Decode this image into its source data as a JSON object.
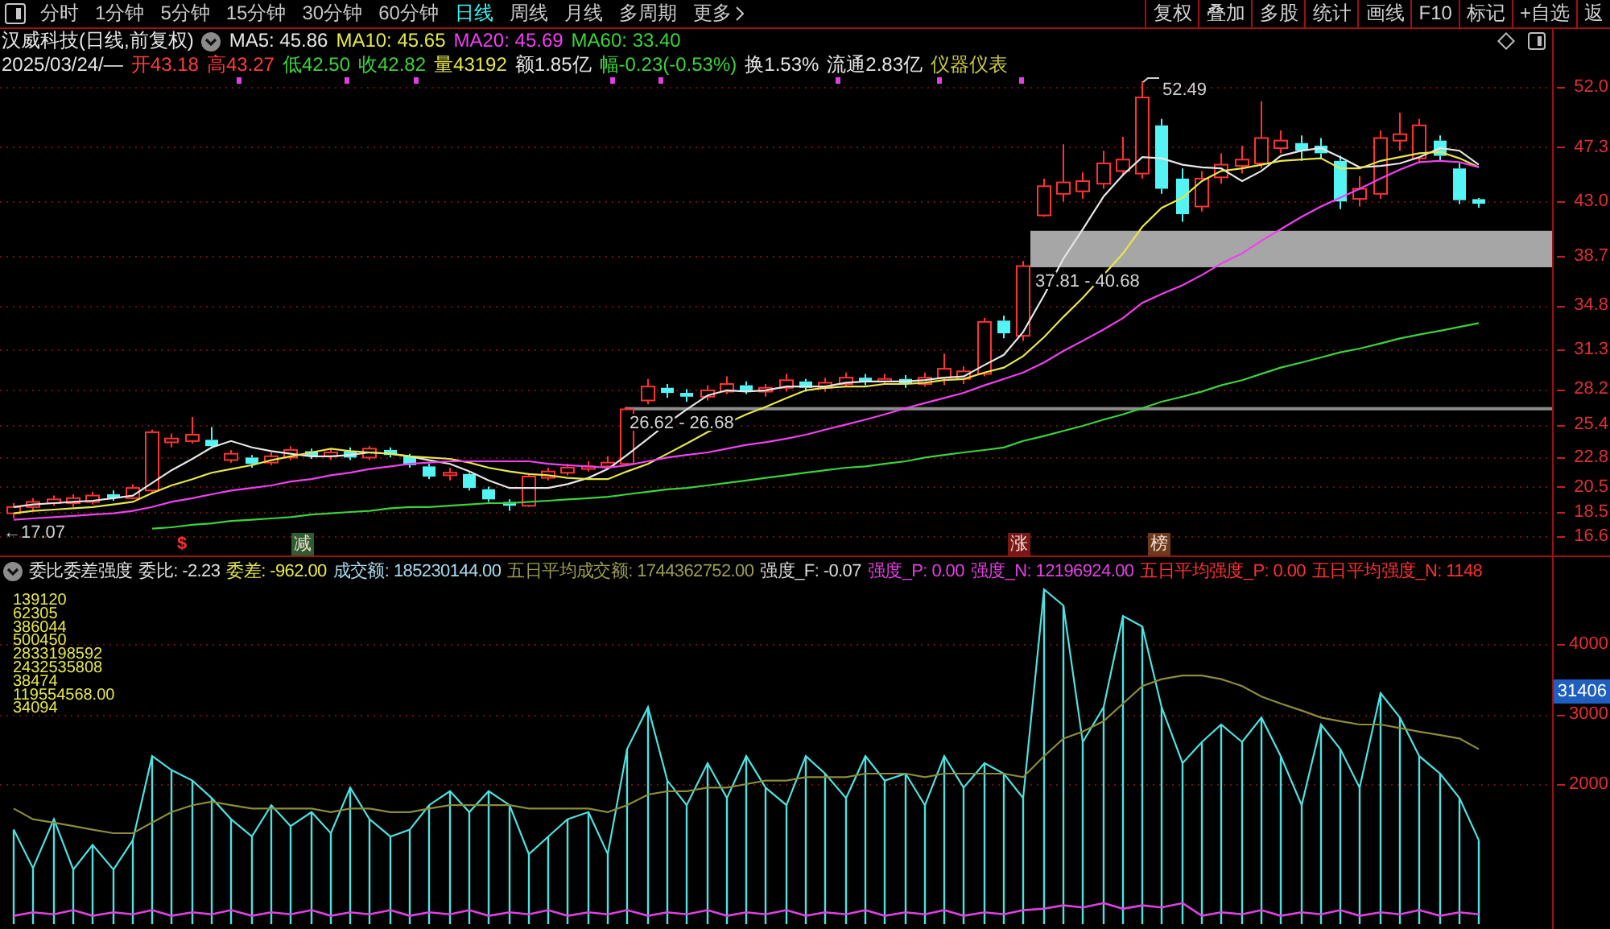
{
  "toolbar": {
    "tabs": [
      {
        "label": "分时",
        "selected": false
      },
      {
        "label": "1分钟",
        "selected": false
      },
      {
        "label": "5分钟",
        "selected": false
      },
      {
        "label": "15分钟",
        "selected": false
      },
      {
        "label": "30分钟",
        "selected": false
      },
      {
        "label": "60分钟",
        "selected": false
      },
      {
        "label": "日线",
        "selected": true
      },
      {
        "label": "周线",
        "selected": false
      },
      {
        "label": "月线",
        "selected": false
      },
      {
        "label": "多周期",
        "selected": false
      }
    ],
    "more": "更多",
    "actions": [
      "复权",
      "叠加",
      "多股",
      "统计",
      "画线",
      "F10",
      "标记",
      "+自选",
      "返"
    ]
  },
  "quote": {
    "title": "汉威科技(日线,前复权)",
    "averages": [
      {
        "label": "MA5: 45.86",
        "color": "#e6e6e6"
      },
      {
        "label": "MA10: 45.65",
        "color": "#e6e64c"
      },
      {
        "label": "MA20: 45.69",
        "color": "#f040f0"
      },
      {
        "label": "MA60: 33.40",
        "color": "#3cd23c"
      }
    ],
    "date": "2025/03/24/—",
    "fields": [
      {
        "text": "开43.18",
        "color": "#ff3c3c"
      },
      {
        "text": "高43.27",
        "color": "#ff3c3c"
      },
      {
        "text": "低42.50",
        "color": "#3cd23c"
      },
      {
        "text": "收42.82",
        "color": "#3cd23c"
      },
      {
        "text": "量43192",
        "color": "#e6e64c"
      },
      {
        "text": "额1.85亿",
        "color": "#e6e6e6"
      },
      {
        "text": "幅-0.23(-0.53%)",
        "color": "#3cd23c"
      },
      {
        "text": "换1.53%",
        "color": "#e6e6e6"
      },
      {
        "text": "流通2.83亿",
        "color": "#e6e6e6"
      },
      {
        "text": "仪器仪表",
        "color": "#c8c83c"
      }
    ]
  },
  "price_chart": {
    "chart_data": {
      "type": "candlestick",
      "grid": true,
      "ylim": [
        16.6,
        56.73
      ],
      "yticks": [
        {
          "value": 52,
          "label": "52.0"
        },
        {
          "value": 47.3,
          "label": "47.3"
        },
        {
          "value": 43,
          "label": "43.0"
        },
        {
          "value": 38.7,
          "label": "38.7"
        },
        {
          "value": 34.8,
          "label": "34.8"
        },
        {
          "value": 31.3,
          "label": "31.3"
        },
        {
          "value": 28.2,
          "label": "28.2"
        },
        {
          "value": 25.4,
          "label": "25.4"
        },
        {
          "value": 22.8,
          "label": "22.8"
        },
        {
          "value": 20.5,
          "label": "20.5"
        },
        {
          "value": 18.5,
          "label": "18.5"
        },
        {
          "value": 16.6,
          "label": "16.6"
        }
      ],
      "ohlc": [
        [
          18.4,
          19.2,
          18.0,
          18.9
        ],
        [
          18.9,
          19.6,
          18.6,
          19.3
        ],
        [
          19.2,
          19.8,
          19.0,
          19.5
        ],
        [
          19.2,
          19.9,
          18.9,
          19.6
        ],
        [
          19.3,
          20.1,
          19.1,
          19.8
        ],
        [
          19.9,
          20.2,
          19.4,
          19.6
        ],
        [
          19.6,
          20.7,
          19.5,
          20.4
        ],
        [
          20.2,
          25.0,
          20.0,
          24.8
        ],
        [
          24.0,
          24.7,
          23.6,
          24.3
        ],
        [
          24.1,
          26.0,
          23.9,
          24.6
        ],
        [
          24.2,
          25.2,
          23.5,
          23.7
        ],
        [
          22.6,
          23.4,
          22.4,
          23.1
        ],
        [
          22.8,
          23.0,
          22.0,
          22.3
        ],
        [
          22.4,
          23.2,
          22.2,
          22.9
        ],
        [
          22.8,
          23.7,
          22.6,
          23.4
        ],
        [
          23.3,
          23.5,
          22.7,
          22.9
        ],
        [
          22.9,
          23.5,
          22.6,
          23.2
        ],
        [
          23.3,
          23.6,
          22.6,
          22.8
        ],
        [
          22.8,
          23.7,
          22.6,
          23.5
        ],
        [
          23.4,
          23.6,
          22.8,
          23.0
        ],
        [
          22.9,
          23.1,
          22.0,
          22.2
        ],
        [
          22.1,
          22.3,
          21.1,
          21.3
        ],
        [
          21.4,
          22.0,
          21.0,
          21.6
        ],
        [
          21.5,
          21.6,
          20.2,
          20.4
        ],
        [
          20.3,
          20.5,
          19.3,
          19.5
        ],
        [
          19.3,
          19.5,
          18.6,
          19.0
        ],
        [
          19.0,
          21.5,
          18.9,
          21.3
        ],
        [
          21.2,
          22.0,
          21.0,
          21.7
        ],
        [
          21.6,
          22.3,
          21.4,
          22.0
        ],
        [
          21.9,
          22.5,
          21.7,
          22.1
        ],
        [
          22.1,
          22.9,
          21.9,
          22.4
        ],
        [
          22.3,
          26.8,
          22.2,
          26.6
        ],
        [
          27.3,
          29.0,
          27.0,
          28.4
        ],
        [
          28.3,
          28.6,
          27.5,
          27.9
        ],
        [
          27.9,
          28.2,
          27.2,
          27.6
        ],
        [
          27.6,
          28.5,
          27.3,
          28.1
        ],
        [
          28.0,
          29.2,
          27.8,
          28.6
        ],
        [
          28.5,
          28.8,
          27.8,
          28.0
        ],
        [
          28.0,
          28.6,
          27.6,
          28.3
        ],
        [
          28.3,
          29.4,
          28.0,
          28.9
        ],
        [
          28.8,
          29.0,
          28.0,
          28.3
        ],
        [
          28.3,
          29.1,
          28.0,
          28.7
        ],
        [
          28.6,
          29.5,
          28.4,
          29.1
        ],
        [
          29.1,
          29.4,
          28.5,
          28.8
        ],
        [
          28.8,
          29.4,
          28.6,
          29.0
        ],
        [
          29.0,
          29.3,
          28.3,
          28.6
        ],
        [
          28.6,
          29.5,
          28.4,
          29.1
        ],
        [
          29.1,
          31.0,
          28.5,
          29.8
        ],
        [
          29.0,
          30.0,
          28.6,
          29.6
        ],
        [
          29.4,
          33.8,
          29.2,
          33.5
        ],
        [
          33.6,
          34.0,
          32.2,
          32.6
        ],
        [
          32.4,
          38.3,
          32.0,
          37.9
        ],
        [
          41.9,
          44.8,
          41.8,
          44.2
        ],
        [
          43.6,
          47.5,
          43.0,
          44.5
        ],
        [
          43.8,
          45.3,
          43.2,
          44.6
        ],
        [
          44.4,
          47.0,
          44.0,
          46.0
        ],
        [
          45.4,
          48.1,
          45.0,
          46.3
        ],
        [
          45.2,
          52.49,
          44.8,
          51.2
        ],
        [
          49.0,
          49.5,
          43.6,
          44.0
        ],
        [
          44.8,
          45.6,
          41.4,
          42.0
        ],
        [
          42.6,
          45.4,
          42.2,
          44.8
        ],
        [
          44.9,
          46.8,
          44.4,
          45.9
        ],
        [
          45.8,
          47.4,
          45.2,
          46.3
        ],
        [
          46.0,
          50.9,
          45.6,
          48.0
        ],
        [
          47.2,
          48.6,
          46.8,
          47.8
        ],
        [
          47.6,
          48.2,
          46.2,
          47.0
        ],
        [
          47.4,
          48.0,
          46.4,
          46.8
        ],
        [
          46.2,
          46.6,
          42.4,
          43.0
        ],
        [
          43.2,
          45.0,
          42.6,
          44.0
        ],
        [
          43.6,
          48.6,
          43.2,
          48.0
        ],
        [
          47.8,
          50.0,
          47.0,
          48.3
        ],
        [
          46.4,
          49.5,
          46.0,
          49.0
        ],
        [
          47.8,
          48.2,
          46.2,
          46.6
        ],
        [
          45.6,
          46.0,
          42.8,
          43.1
        ],
        [
          43.18,
          43.27,
          42.5,
          42.82
        ]
      ],
      "series": [
        {
          "type": "line",
          "color": "#e6e6e6",
          "values": [
            18.9,
            19.1,
            19.2,
            19.3,
            19.4,
            19.6,
            19.8,
            20.8,
            21.8,
            22.7,
            23.6,
            24.1,
            23.6,
            23.3,
            23.1,
            22.9,
            22.9,
            23.0,
            23.2,
            23.1,
            22.9,
            22.6,
            22.3,
            21.7,
            21.0,
            20.4,
            20.4,
            20.4,
            20.7,
            21.2,
            21.9,
            23.0,
            24.3,
            25.5,
            26.6,
            27.7,
            28.1,
            28.0,
            28.1,
            28.4,
            28.4,
            28.4,
            28.7,
            28.8,
            28.8,
            28.8,
            28.9,
            29.1,
            29.2,
            30.1,
            30.9,
            32.7,
            35.6,
            38.5,
            40.8,
            43.4,
            45.1,
            46.5,
            46.4,
            45.9,
            45.7,
            45.6,
            44.6,
            45.4,
            46.6,
            47.0,
            47.2,
            46.5,
            45.7,
            45.8,
            46.0,
            46.5,
            47.2,
            47.0,
            45.9
          ]
        },
        {
          "type": "line",
          "color": "#e6e64c",
          "values": [
            18.4,
            18.6,
            18.7,
            18.8,
            18.9,
            19.1,
            19.3,
            20.0,
            20.6,
            21.1,
            21.6,
            21.9,
            22.2,
            22.6,
            22.9,
            23.2,
            23.5,
            23.3,
            23.2,
            23.1,
            22.9,
            22.8,
            22.7,
            22.4,
            22.0,
            21.7,
            21.5,
            21.4,
            21.2,
            21.1,
            21.1,
            21.7,
            22.3,
            23.1,
            23.9,
            24.8,
            25.5,
            26.2,
            26.8,
            27.5,
            28.1,
            28.3,
            28.4,
            28.4,
            28.6,
            28.6,
            28.7,
            28.9,
            29.0,
            29.5,
            29.9,
            30.8,
            32.3,
            33.9,
            35.4,
            37.2,
            38.9,
            41.0,
            42.5,
            43.3,
            44.6,
            45.4,
            45.6,
            45.9,
            46.2,
            46.3,
            46.4,
            45.6,
            45.6,
            46.2,
            46.5,
            46.8,
            46.9,
            46.4,
            45.7
          ]
        },
        {
          "type": "line",
          "color": "#f040f0",
          "values": [
            17.9,
            18.0,
            18.1,
            18.2,
            18.3,
            18.4,
            18.6,
            18.9,
            19.3,
            19.6,
            19.9,
            20.2,
            20.4,
            20.6,
            20.9,
            21.1,
            21.4,
            21.6,
            21.9,
            22.1,
            22.3,
            22.4,
            22.5,
            22.5,
            22.5,
            22.5,
            22.5,
            22.3,
            22.2,
            22.1,
            22.0,
            22.2,
            22.5,
            22.8,
            23.0,
            23.2,
            23.5,
            23.8,
            24.0,
            24.3,
            24.6,
            25.0,
            25.4,
            25.8,
            26.2,
            26.7,
            27.1,
            27.5,
            27.9,
            28.5,
            29.0,
            29.5,
            30.3,
            31.2,
            32.0,
            32.9,
            33.8,
            35.0,
            35.7,
            36.4,
            37.2,
            38.1,
            38.9,
            39.9,
            40.8,
            41.8,
            42.6,
            43.3,
            44.0,
            44.8,
            45.5,
            46.1,
            46.2,
            46.1,
            45.7
          ]
        },
        {
          "type": "line",
          "color": "#3cd23c",
          "values": [
            null,
            null,
            null,
            null,
            null,
            null,
            null,
            17.2,
            17.3,
            17.5,
            17.6,
            17.8,
            17.9,
            18.0,
            18.1,
            18.3,
            18.4,
            18.5,
            18.6,
            18.8,
            18.9,
            18.9,
            19.0,
            19.1,
            19.2,
            19.2,
            19.3,
            19.4,
            19.5,
            19.6,
            19.7,
            19.9,
            20.1,
            20.3,
            20.4,
            20.6,
            20.8,
            21.0,
            21.2,
            21.4,
            21.6,
            21.8,
            22.0,
            22.1,
            22.3,
            22.5,
            22.8,
            23.0,
            23.2,
            23.4,
            23.6,
            24.1,
            24.5,
            24.9,
            25.3,
            25.8,
            26.2,
            26.7,
            27.2,
            27.6,
            28.0,
            28.5,
            28.9,
            29.4,
            29.9,
            30.3,
            30.7,
            31.1,
            31.4,
            31.8,
            32.2,
            32.5,
            32.8,
            33.1,
            33.4
          ]
        }
      ],
      "bands": [
        {
          "axis": "y",
          "from": 37.81,
          "to": 40.68,
          "color": "#a6a6a6",
          "label": "37.81 - 40.68"
        },
        {
          "axis": "y",
          "from": 26.62,
          "to": 26.68,
          "color": "#8c8c8c",
          "label": "26.62 - 26.68"
        }
      ]
    },
    "high_label": "52.49",
    "low_label": "←17.07",
    "signals": [
      {
        "label": "$",
        "kind": "plain",
        "color": "#ff3030"
      },
      {
        "label": "减",
        "kind": "tag",
        "color": "#2e5e2e"
      },
      {
        "label": "涨",
        "kind": "tag",
        "color": "#7a1818"
      },
      {
        "label": "榜",
        "kind": "tag",
        "color": "#6e3a1c"
      }
    ]
  },
  "indicator": {
    "title": "委比委差强度",
    "values": [
      {
        "text": "委比: -2.23",
        "color": "#e0e0e0"
      },
      {
        "text": "委差: -962.00",
        "color": "#e6e64c"
      },
      {
        "text": "成交额: 185230144.00",
        "color": "#a8d8ec"
      },
      {
        "text": "五日平均成交额: 1744362752.00",
        "color": "#9c9c50"
      },
      {
        "text": "强度_F: -0.07",
        "color": "#d8d8d8"
      },
      {
        "text": "强度_P: 0.00",
        "color": "#e040e0"
      },
      {
        "text": "强度_N: 12196924.00",
        "color": "#e040e0"
      },
      {
        "text": "五日平均强度_P: 0.00",
        "color": "#ff3030"
      },
      {
        "text": "五日平均强度_N: 1148",
        "color": "#ff3030"
      }
    ],
    "readings": [
      "139120",
      "62305",
      "386044",
      "500450",
      "2833198592",
      "2432535808",
      "38474",
      "119554568.00",
      "34094"
    ],
    "chart_data": {
      "type": "line",
      "grid": true,
      "ylim": [
        -69,
        4828
      ],
      "yticks": [
        {
          "value": 4000,
          "label": "4000"
        },
        {
          "value": 3000,
          "label": "3000"
        },
        {
          "value": 2000,
          "label": "2000"
        }
      ],
      "series": [
        {
          "type": "bar",
          "color": "#4fe0e0",
          "values": [
            1350,
            800,
            1500,
            780,
            1130,
            780,
            1200,
            2400,
            2200,
            2050,
            1800,
            1500,
            1250,
            1700,
            1400,
            1600,
            1300,
            1950,
            1500,
            1250,
            1350,
            1700,
            1900,
            1600,
            1900,
            1700,
            1000,
            1250,
            1500,
            1600,
            1000,
            2500,
            3100,
            2050,
            1700,
            2300,
            1800,
            2400,
            1950,
            1700,
            2400,
            2150,
            1800,
            2400,
            2050,
            2150,
            1700,
            2400,
            1950,
            2300,
            2150,
            1800,
            4780,
            4550,
            2600,
            3100,
            4400,
            4250,
            3100,
            2300,
            2600,
            2850,
            2600,
            2950,
            2400,
            1700,
            2850,
            2500,
            1950,
            3300,
            2950,
            2400,
            2150,
            1800,
            1200
          ]
        },
        {
          "type": "line",
          "color": "#4fe0e0",
          "values": [
            1350,
            800,
            1500,
            780,
            1130,
            780,
            1200,
            2400,
            2200,
            2050,
            1800,
            1500,
            1250,
            1700,
            1400,
            1600,
            1300,
            1950,
            1500,
            1250,
            1350,
            1700,
            1900,
            1600,
            1900,
            1700,
            1000,
            1250,
            1500,
            1600,
            1000,
            2500,
            3100,
            2050,
            1700,
            2300,
            1800,
            2400,
            1950,
            1700,
            2400,
            2150,
            1800,
            2400,
            2050,
            2150,
            1700,
            2400,
            1950,
            2300,
            2150,
            1800,
            4780,
            4550,
            2600,
            3100,
            4400,
            4250,
            3100,
            2300,
            2600,
            2850,
            2600,
            2950,
            2400,
            1700,
            2850,
            2500,
            1950,
            3300,
            2950,
            2400,
            2150,
            1800,
            1200
          ]
        },
        {
          "type": "line",
          "color": "#8c8c3c",
          "values": [
            1650,
            1500,
            1450,
            1400,
            1350,
            1300,
            1300,
            1450,
            1600,
            1700,
            1750,
            1700,
            1650,
            1650,
            1650,
            1650,
            1600,
            1650,
            1650,
            1600,
            1600,
            1650,
            1700,
            1700,
            1700,
            1700,
            1650,
            1650,
            1650,
            1650,
            1600,
            1700,
            1850,
            1900,
            1900,
            1950,
            1950,
            2000,
            2050,
            2050,
            2100,
            2100,
            2100,
            2150,
            2150,
            2150,
            2100,
            2150,
            2150,
            2150,
            2150,
            2100,
            2400,
            2650,
            2750,
            2900,
            3150,
            3400,
            3500,
            3550,
            3550,
            3500,
            3400,
            3250,
            3150,
            3050,
            2950,
            2900,
            2850,
            2850,
            2800,
            2750,
            2700,
            2650,
            2500
          ]
        },
        {
          "type": "line",
          "color": "#e040e0",
          "values": [
            120,
            170,
            140,
            200,
            120,
            170,
            140,
            200,
            120,
            170,
            140,
            200,
            120,
            170,
            140,
            200,
            120,
            170,
            140,
            200,
            120,
            170,
            140,
            200,
            120,
            170,
            140,
            200,
            120,
            170,
            140,
            200,
            120,
            170,
            140,
            200,
            120,
            170,
            140,
            200,
            120,
            170,
            140,
            200,
            120,
            170,
            140,
            200,
            120,
            170,
            140,
            200,
            220,
            270,
            240,
            300,
            220,
            270,
            240,
            300,
            120,
            170,
            140,
            200,
            120,
            170,
            140,
            200,
            120,
            170,
            140,
            200,
            120,
            170,
            140
          ]
        }
      ]
    },
    "cursor_value": "31406"
  }
}
